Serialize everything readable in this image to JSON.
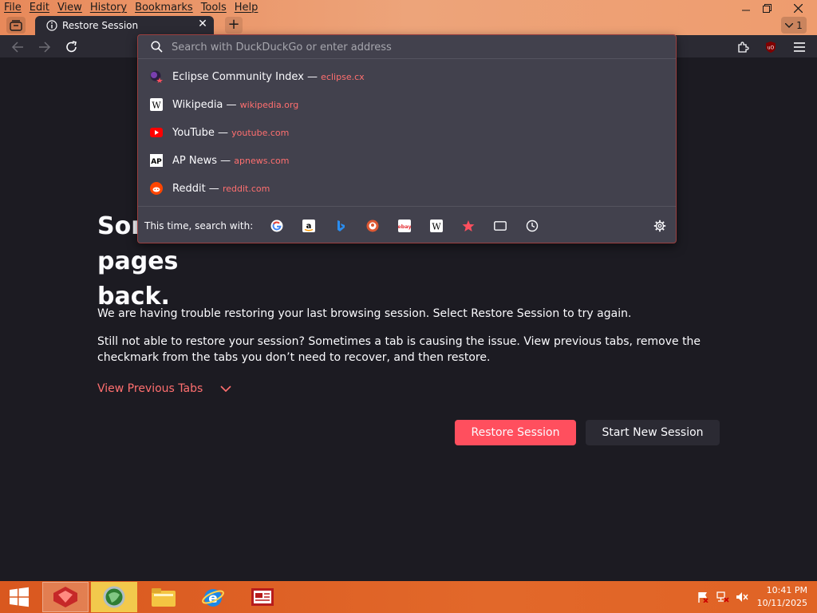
{
  "menu": [
    "File",
    "Edit",
    "View",
    "History",
    "Bookmarks",
    "Tools",
    "Help"
  ],
  "tab": {
    "title": "Restore Session",
    "close": "✕",
    "new": "+"
  },
  "tab_list": {
    "count": "1"
  },
  "urlbar": {
    "placeholder": "Search with DuckDuckGo or enter address"
  },
  "results": [
    {
      "title": "Eclipse Community Index",
      "sep": " — ",
      "url": "eclipse.cx"
    },
    {
      "title": "Wikipedia",
      "sep": " — ",
      "url": "wikipedia.org"
    },
    {
      "title": "YouTube",
      "sep": " — ",
      "url": "youtube.com"
    },
    {
      "title": "AP News",
      "sep": " — ",
      "url": "apnews.com"
    },
    {
      "title": "Reddit",
      "sep": " — ",
      "url": "reddit.com"
    }
  ],
  "search_with": {
    "label": "This time, search with:"
  },
  "page": {
    "title_line1": "Sorry. We’re having trouble getting your pages",
    "title_line2": "back.",
    "p1": "We are having trouble restoring your last browsing session. Select Restore Session to try again.",
    "p2": "Still not able to restore your session? Sometimes a tab is causing the issue. View previous tabs, remove the checkmark from the tabs you don’t need to recover, and then restore.",
    "view_previous": "View Previous Tabs",
    "restore_button": "Restore Session",
    "new_session_button": "Start New Session"
  },
  "taskbar": {
    "time": "10:41 PM",
    "date": "10/11/2025"
  },
  "colors": {
    "accent": "#ff4f5e",
    "link": "#ff6f6f",
    "background": "#1c1b22",
    "taskbar": "#e2682a"
  }
}
